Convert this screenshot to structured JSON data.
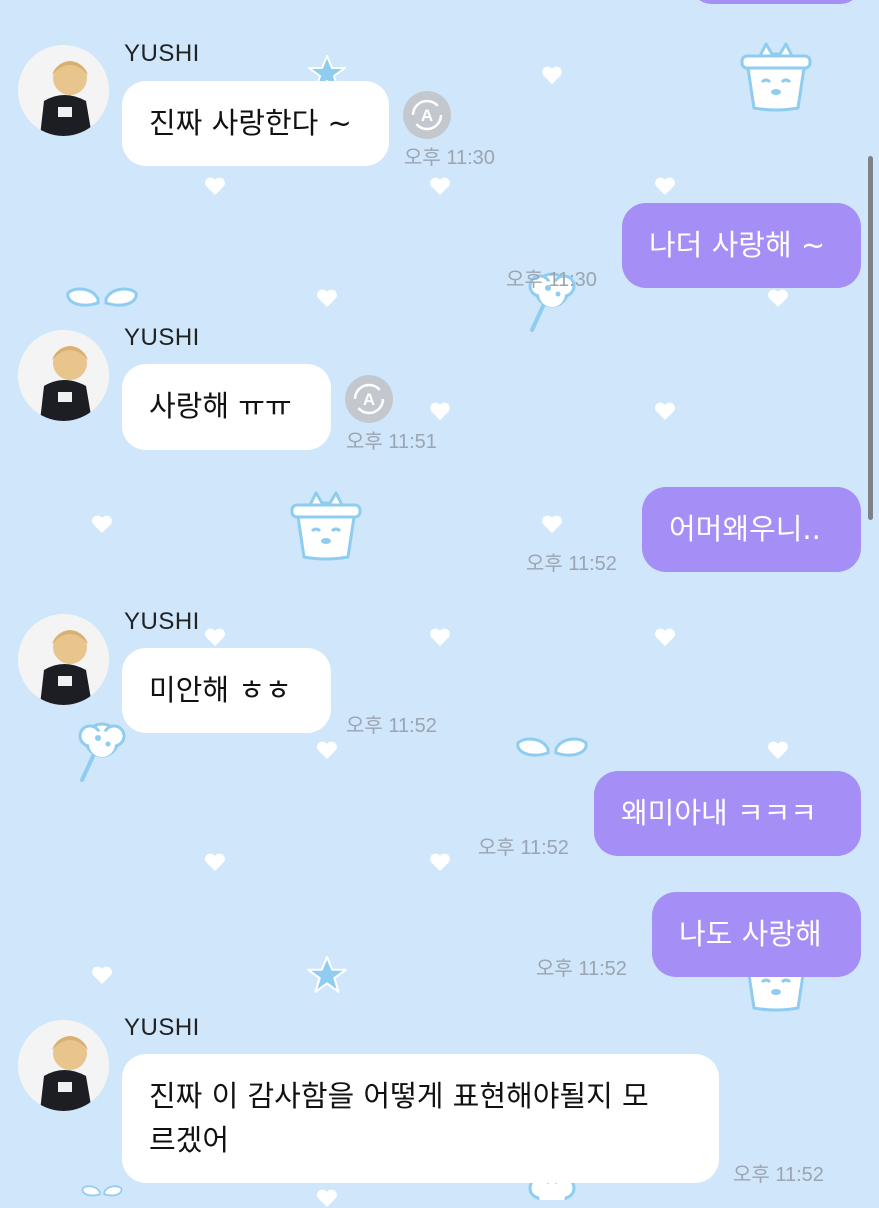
{
  "theme": {
    "background": "#cfe6fb",
    "out_bubble": "#a58ef5",
    "in_bubble": "#ffffff",
    "timestamp": "#9aa5b1",
    "deco": "#8fcdf0"
  },
  "icons": {
    "translate": "translate-icon",
    "avatar": "avatar-photo"
  },
  "messages": [
    {
      "dir": "in",
      "sender": "YUSHI",
      "text": "진짜 사랑한다 ~",
      "time": "오후 11:30",
      "translate": true
    },
    {
      "dir": "out",
      "text": "나더 사랑해 ~",
      "time": "오후 11:30"
    },
    {
      "dir": "in",
      "sender": "YUSHI",
      "text": "사랑해 ㅠㅠ",
      "time": "오후 11:51",
      "translate": true
    },
    {
      "dir": "out",
      "text": "어머왜우니..",
      "time": "오후 11:52"
    },
    {
      "dir": "in",
      "sender": "YUSHI",
      "text": "미안해 ㅎㅎ",
      "time": "오후 11:52"
    },
    {
      "dir": "out",
      "text": "왜미아내 ㅋㅋㅋ",
      "time": "오후 11:52"
    },
    {
      "dir": "out",
      "text": "나도 사랑해",
      "time": "오후 11:52"
    },
    {
      "dir": "in",
      "sender": "YUSHI",
      "text_line1": "진짜 이 감사함을 어떻게 표현해야될지 모",
      "text_line2": "르겠어",
      "time": "오후 11:52"
    }
  ]
}
